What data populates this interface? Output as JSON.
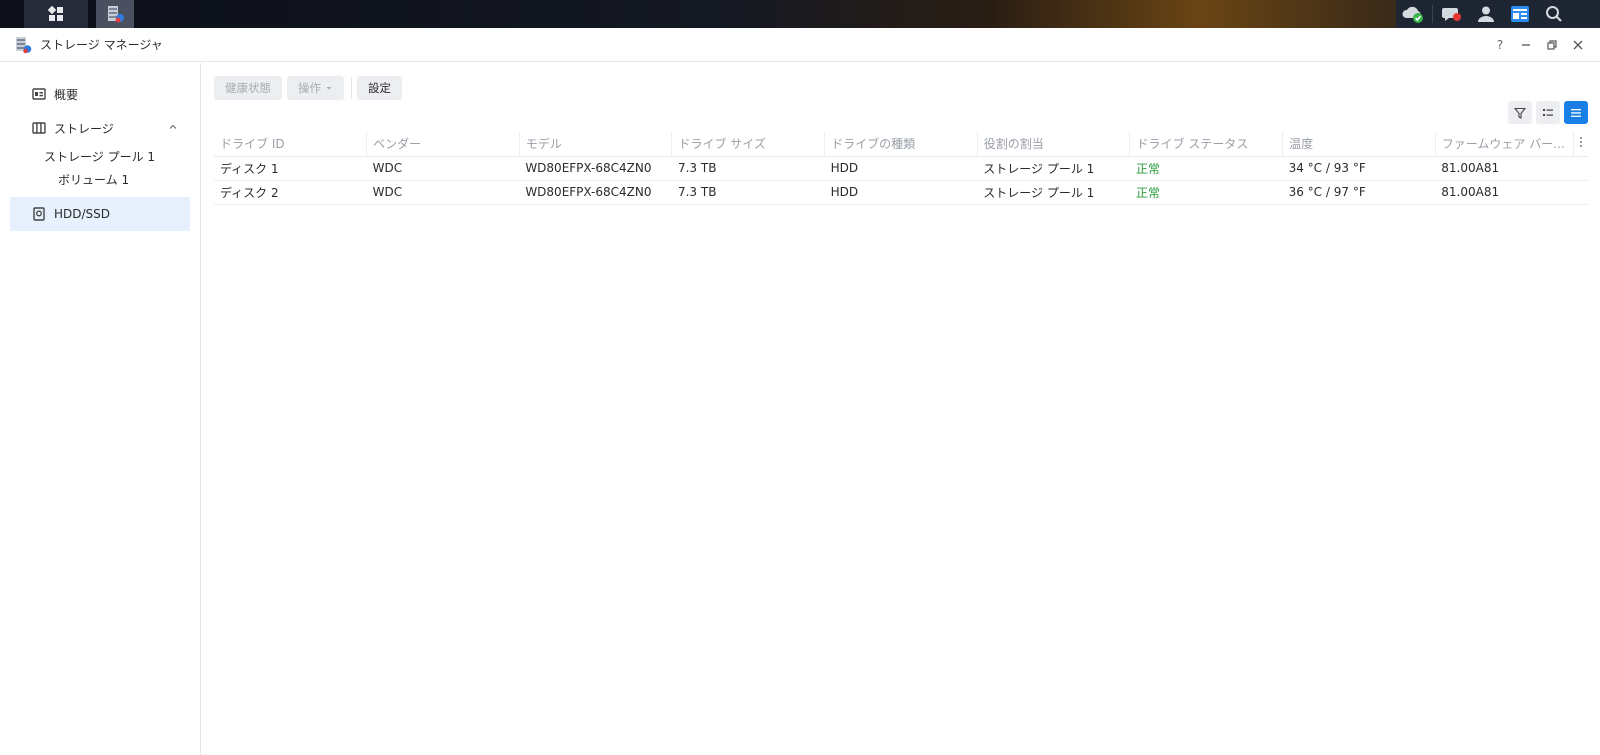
{
  "window": {
    "title": "ストレージ マネージャ",
    "help_label": "?"
  },
  "sidebar": {
    "items": [
      {
        "label": "概要",
        "icon": "overview-icon"
      },
      {
        "label": "ストレージ",
        "icon": "storage-icon",
        "expanded": true
      },
      {
        "label": "ストレージ プール 1"
      },
      {
        "label": "ボリューム 1"
      },
      {
        "label": "HDD/SSD",
        "icon": "hdd-icon",
        "active": true
      }
    ]
  },
  "toolbar": {
    "health_label": "健康状態",
    "action_label": "操作",
    "settings_label": "設定"
  },
  "table": {
    "columns": [
      "ドライブ ID",
      "ベンダー",
      "モデル",
      "ドライブ サイズ",
      "ドライブの種類",
      "役割の割当",
      "ドライブ ステータス",
      "温度",
      "ファームウェア バージョン"
    ],
    "rows": [
      [
        "ディスク 1",
        "WDC",
        "WD80EFPX-68C4ZN0",
        "7.3 TB",
        "HDD",
        "ストレージ プール 1",
        "正常",
        "34 °C / 93 °F",
        "81.00A81"
      ],
      [
        "ディスク 2",
        "WDC",
        "WD80EFPX-68C4ZN0",
        "7.3 TB",
        "HDD",
        "ストレージ プール 1",
        "正常",
        "36 °C / 97 °F",
        "81.00A81"
      ]
    ]
  },
  "colors": {
    "accent": "#1a7fe5",
    "status_ok": "#2e9e3f",
    "active_nav_bg": "#e6f1fd"
  }
}
